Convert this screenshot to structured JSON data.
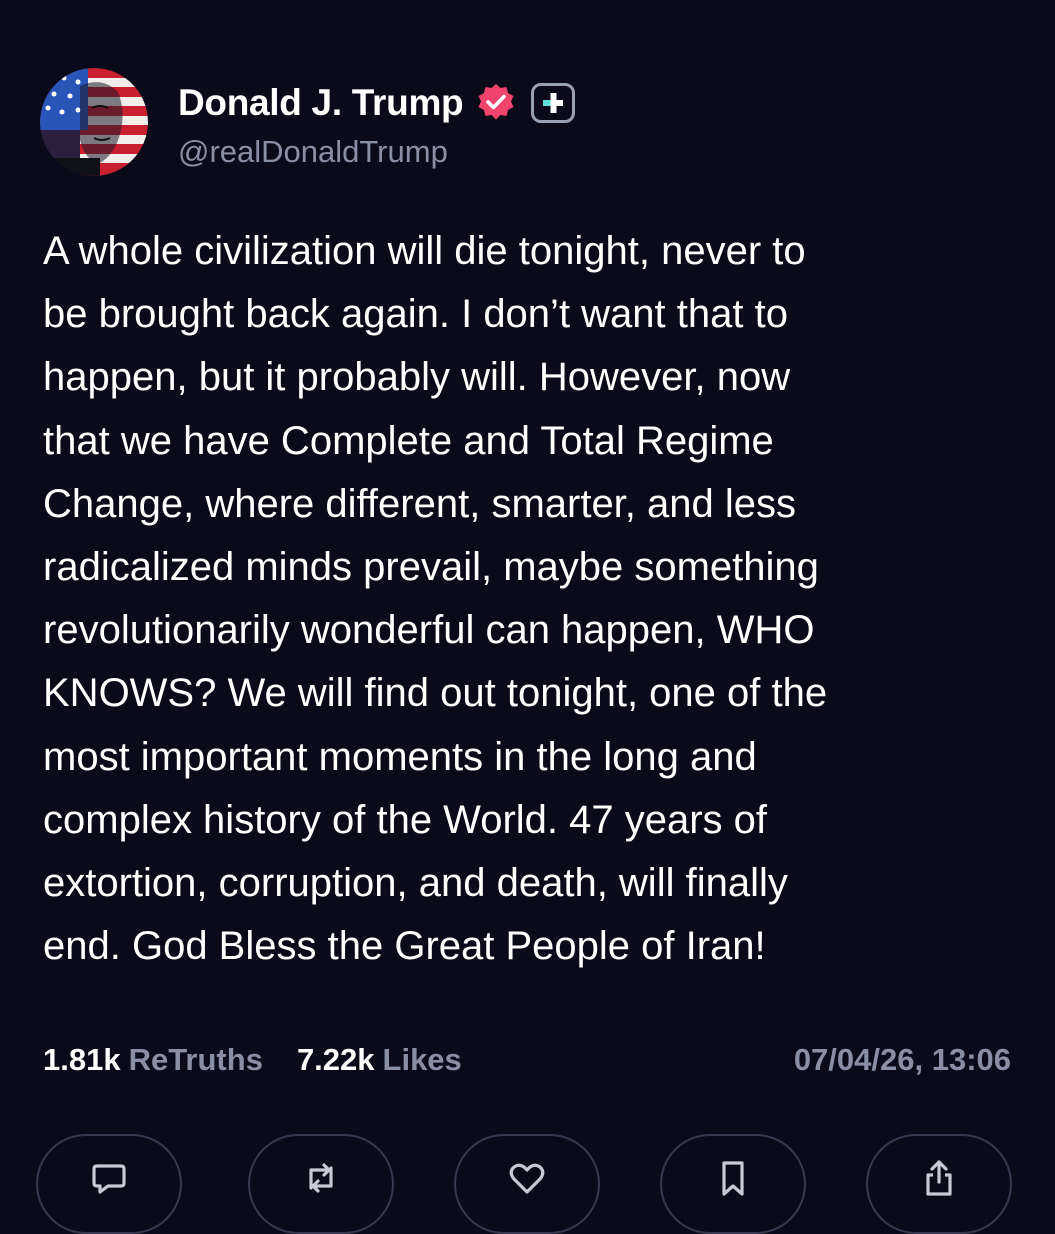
{
  "author": {
    "display_name": "Donald J. Trump",
    "handle": "@realDonaldTrump",
    "avatar_icon": "avatar-portrait-flag",
    "verified_icon": "verified-badge-icon",
    "verified_color": "#f0446c",
    "plus_icon": "plus-badge-icon",
    "plus_color": "#5de0d8"
  },
  "post": {
    "lines": [
      "A whole civilization will die tonight, never to",
      "be brought back again. I don’t want that to",
      "happen, but it probably will. However, now",
      "that we have Complete and Total Regime",
      "Change, where different, smarter, and less",
      "radicalized minds prevail, maybe something",
      "revolutionarily wonderful can happen, WHO",
      "KNOWS? We will find out tonight, one of the",
      "most important moments in the long and",
      "complex history of the World. 47 years of",
      "extortion, corruption, and death, will finally",
      "end. God Bless the Great People of Iran!"
    ]
  },
  "stats": {
    "retruths_count": "1.81k",
    "retruths_label": "ReTruths",
    "likes_count": "7.22k",
    "likes_label": "Likes",
    "timestamp": "07/04/26, 13:06"
  },
  "actions": [
    {
      "icon": "reply-icon"
    },
    {
      "icon": "retruth-icon"
    },
    {
      "icon": "like-icon"
    },
    {
      "icon": "bookmark-icon"
    },
    {
      "icon": "share-icon"
    }
  ],
  "colors": {
    "background": "#0b0a1a",
    "text": "#ffffff",
    "muted": "#8b8fa6",
    "button_border": "#3a3850"
  }
}
